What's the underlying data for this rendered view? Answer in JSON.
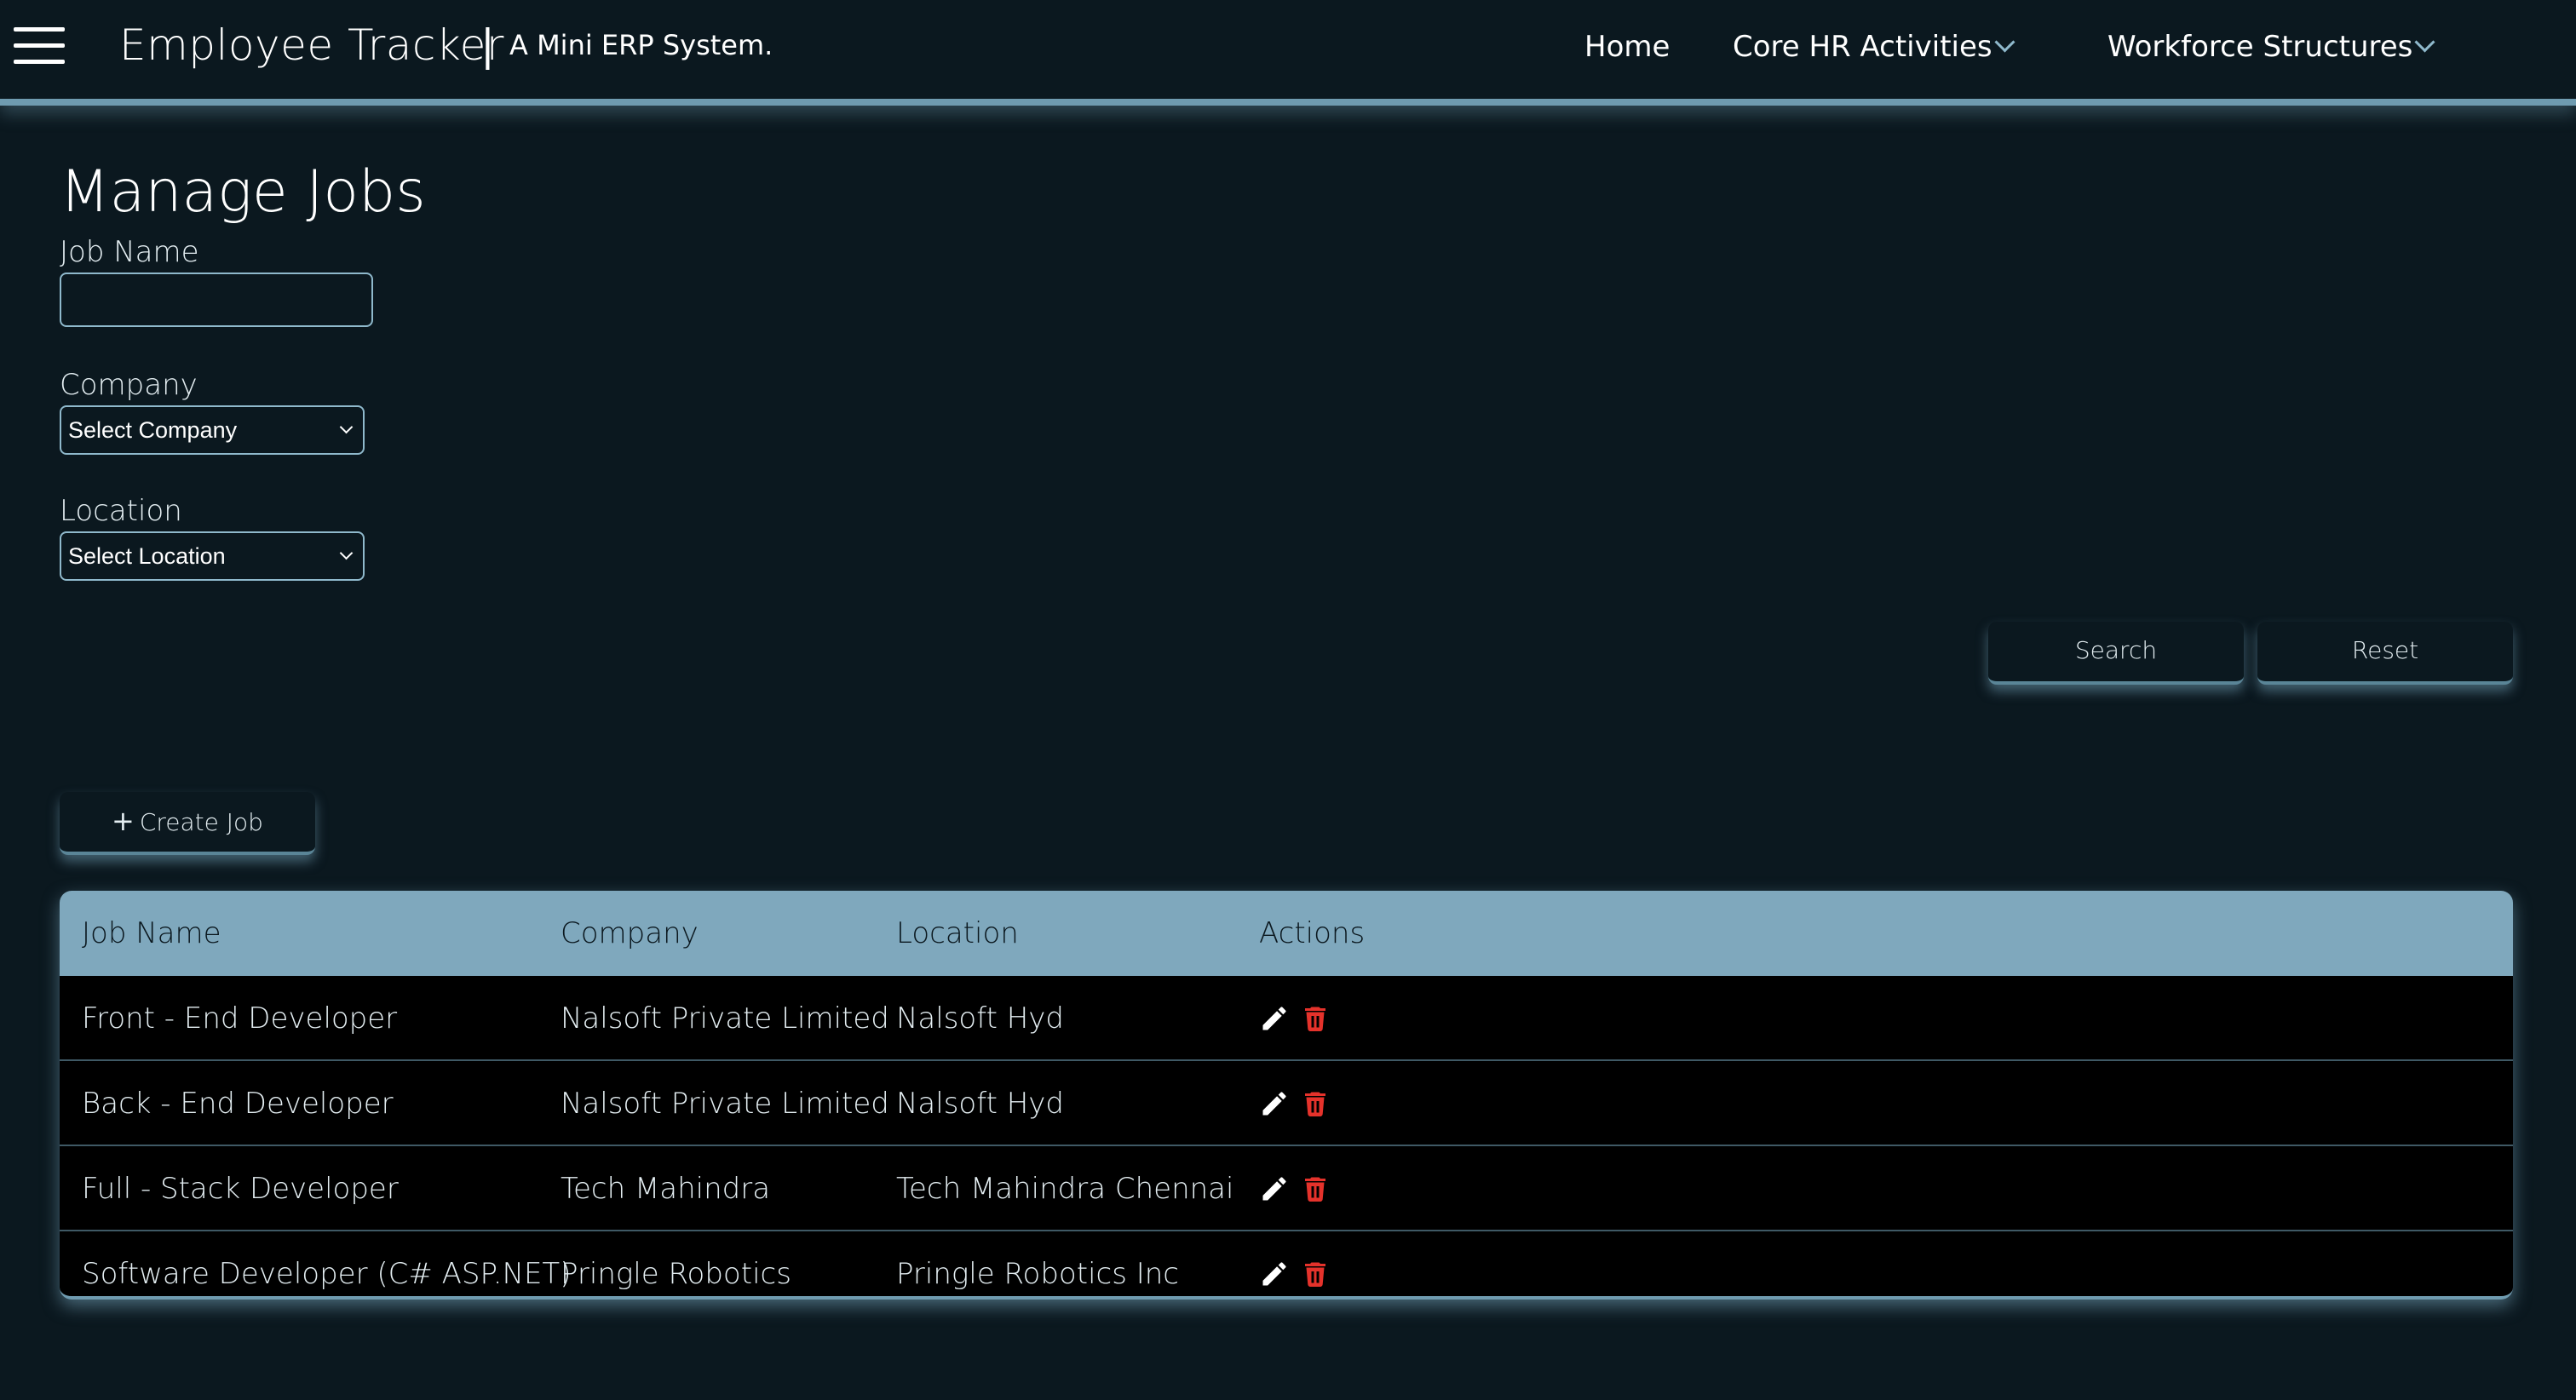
{
  "header": {
    "app_title": "Employee Tracker",
    "separator": "|",
    "subtitle": "A Mini ERP System.",
    "nav": [
      {
        "label": "Home"
      },
      {
        "label": "Core HR Activities"
      },
      {
        "label": "Workforce Structures"
      }
    ]
  },
  "page": {
    "title": "Manage Jobs"
  },
  "form": {
    "job_name_label": "Job Name",
    "job_name_value": "",
    "company_label": "Company",
    "company_selected": "Select Company",
    "location_label": "Location",
    "location_selected": "Select Location",
    "search_label": "Search",
    "reset_label": "Reset"
  },
  "actions": {
    "create_job_label": "Create Job"
  },
  "table": {
    "columns": [
      "Job Name",
      "Company",
      "Location",
      "Actions"
    ],
    "rows": [
      {
        "job_name": "Front - End Developer",
        "company": "Nalsoft Private Limited",
        "location": "Nalsoft Hyd"
      },
      {
        "job_name": "Back - End Developer",
        "company": "Nalsoft Private Limited",
        "location": "Nalsoft Hyd"
      },
      {
        "job_name": "Full - Stack Developer",
        "company": "Tech Mahindra",
        "location": "Tech Mahindra Chennai"
      },
      {
        "job_name": "Software Developer (C# ASP.NET)",
        "company": "Pringle Robotics",
        "location": "Pringle Robotics Inc"
      }
    ]
  },
  "icons": {
    "menu": "hamburger-menu-icon",
    "edit": "pencil-icon",
    "delete": "trash-icon"
  },
  "colors": {
    "background": "#0b181f",
    "accent": "#7fa8bd",
    "delete": "#e5322b"
  }
}
